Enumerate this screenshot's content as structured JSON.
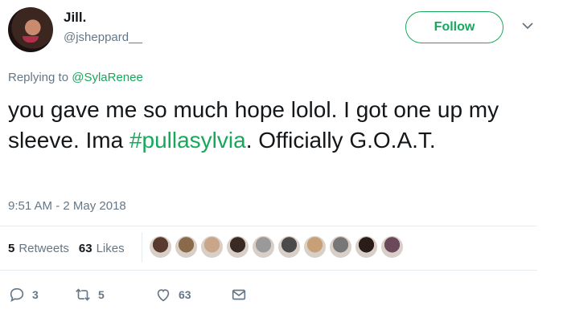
{
  "author": {
    "name": "Jill.",
    "handle": "@jsheppard__",
    "avatar_icon": "user-avatar"
  },
  "follow_label": "Follow",
  "reply": {
    "prefix": "Replying to ",
    "mention": "@SylaRenee"
  },
  "tweet": {
    "text_before": "you gave me so much hope lolol. I got one up my sleeve. Ima ",
    "hashtag": "#pullasylvia",
    "text_after": ". Officially G.O.A.T."
  },
  "timestamp": "9:51 AM - 2 May 2018",
  "stats": {
    "retweets_count": "5",
    "retweets_label": "Retweets",
    "likes_count": "63",
    "likes_label": "Likes"
  },
  "likers_count_shown": 10,
  "liker_colors": [
    "#5a3a2e",
    "#8a6a4a",
    "#c9a58a",
    "#3a2a24",
    "#9a9a9a",
    "#4a4a4a",
    "#c8a078",
    "#777777",
    "#2a1c18",
    "#6a4a5a"
  ],
  "actions": {
    "reply_count": "3",
    "retweet_count": "5",
    "like_count": "63"
  },
  "colors": {
    "accent": "#17a85b",
    "muted": "#657786",
    "text": "#14171a"
  }
}
